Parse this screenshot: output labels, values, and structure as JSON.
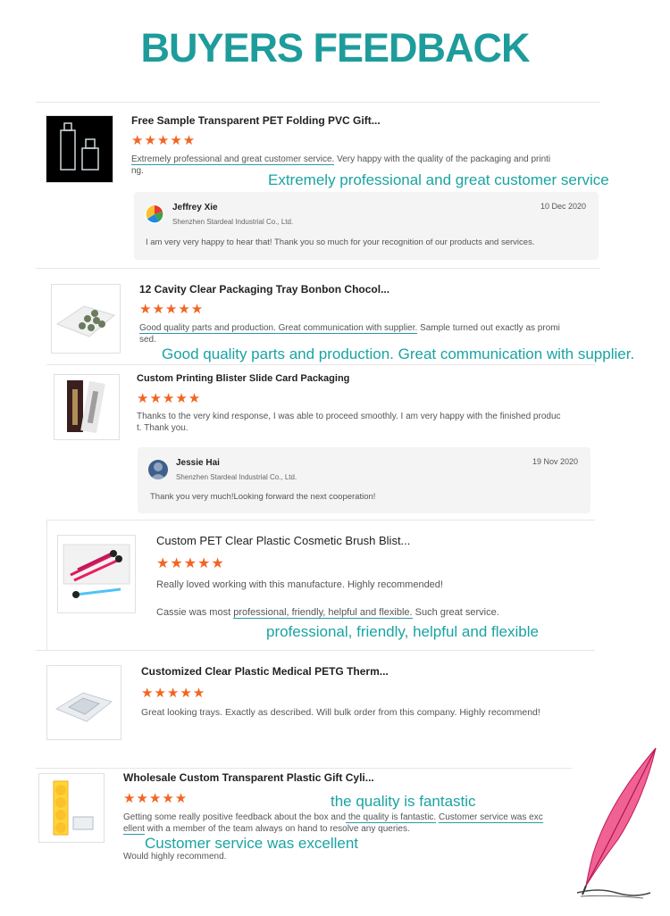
{
  "page": {
    "title": "BUYERS FEEDBACK"
  },
  "colors": {
    "accent": "#1e9c9c",
    "stars": "#f26522"
  },
  "reviews": [
    {
      "product": "Free Sample Transparent PET Folding PVC Gift...",
      "stars": "★★★★★",
      "text_highlight": "Extremely professional and great customer service.",
      "text_rest_1": " Very happy with the quality of the packaging and printi",
      "text_rest_2": "ng.",
      "callout": "Extremely professional and great customer service",
      "reply": {
        "name": "Jeffrey Xie",
        "company": "Shenzhen Stardeal Industrial Co., Ltd.",
        "date": "10 Dec 2020",
        "message": "I am very very happy to hear that! Thank you so much for your recognition of our products and services."
      }
    },
    {
      "product": "12 Cavity Clear Packaging Tray Bonbon Chocol...",
      "stars": "★★★★★",
      "text_highlight": "Good quality parts and production. Great communication with supplier.",
      "text_rest_1": " Sample turned out exactly as promi",
      "text_rest_2": "sed.",
      "callout": "Good quality parts and production. Great communication with supplier."
    },
    {
      "product": "Custom Printing Blister Slide Card Packaging",
      "stars": "★★★★★",
      "text_line_1": "Thanks to the very kind response, I was able to proceed smoothly. I am very happy with the finished produc",
      "text_line_2": "t. Thank you.",
      "reply": {
        "name": "Jessie Hai",
        "company": "Shenzhen Stardeal Industrial Co., Ltd.",
        "date": "19 Nov 2020",
        "message": "Thank you very much!Looking forward the next cooperation!"
      }
    },
    {
      "product": "Custom PET Clear Plastic Cosmetic Brush Blist...",
      "stars": "★★★★★",
      "text_line_1": "Really loved working with this manufacture. Highly recommended!",
      "text_pre": "Cassie was most ",
      "text_highlight": "professional, friendly, helpful and flexible.",
      "text_post": " Such great service.",
      "callout": "professional, friendly, helpful and flexible"
    },
    {
      "product": "Customized Clear Plastic Medical PETG Therm...",
      "stars": "★★★★★",
      "text_line_1": "Great looking trays.  Exactly as described.  Will bulk order from this company.  Highly recommend!"
    },
    {
      "product": "Wholesale Custom Transparent Plastic Gift Cyli...",
      "stars": "★★★★★",
      "text_pre": "Getting some really positive feedback about the box and",
      "text_highlight_1": " the quality is fantastic.",
      "text_mid": " ",
      "text_highlight_2a": "Customer service was exc",
      "text_highlight_2b": "ellent",
      "text_rest": " with a member of the team always on hand to resolve any queries.",
      "text_line_3": "Would highly recommend.",
      "callout_1": "the quality is fantastic",
      "callout_2": "Customer service was excellent"
    }
  ]
}
